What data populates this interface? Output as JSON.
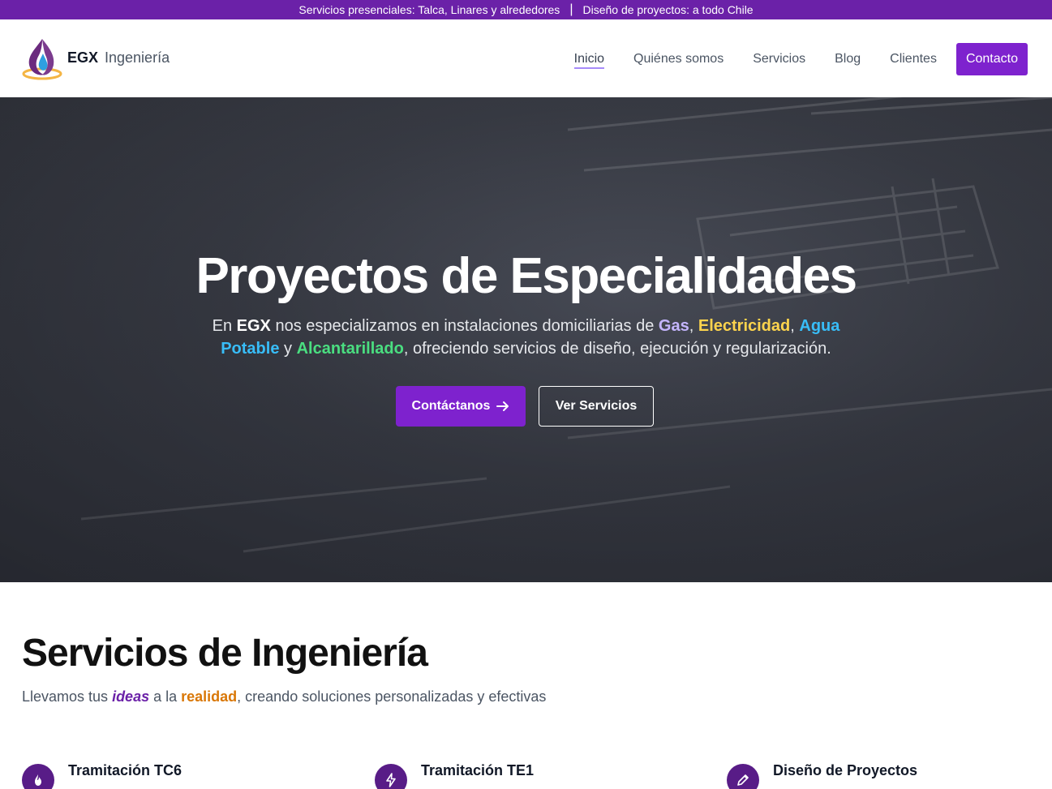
{
  "topbar": {
    "left": "Servicios presenciales: Talca, Linares y alrededores",
    "separator": "|",
    "right": "Diseño de proyectos: a todo Chile"
  },
  "brand": {
    "name": "EGX",
    "suffix": "Ingeniería",
    "logo_icon": "flame-drop-logo"
  },
  "nav": {
    "items": [
      {
        "label": "Inicio",
        "active": true
      },
      {
        "label": "Quiénes somos"
      },
      {
        "label": "Servicios"
      },
      {
        "label": "Blog"
      },
      {
        "label": "Clientes"
      }
    ],
    "cta": "Contacto"
  },
  "hero": {
    "title": "Proyectos de Especialidades",
    "text": {
      "p1": "En ",
      "egx": "EGX",
      "p2": " nos especializamos en instalaciones domiciliarias de ",
      "gas": "Gas",
      "comma1": ", ",
      "electricidad": "Electricidad",
      "comma2": ", ",
      "agua": "Agua Potable",
      "y": " y ",
      "alcantarillado": "Alcantarillado",
      "p3": ", ofreciendo servicios de diseño, ejecución y regularización."
    },
    "primary_button": "Contáctanos",
    "secondary_button": "Ver Servicios"
  },
  "services": {
    "title": "Servicios de Ingeniería",
    "subtitle": {
      "p1": "Llevamos tus ",
      "ideas": "ideas",
      "p2": " a la ",
      "realidad": "realidad",
      "p3": ", creando soluciones personalizadas y efectivas"
    },
    "items": [
      {
        "label": "Tramitación TC6",
        "icon": "flame-icon"
      },
      {
        "label": "Tramitación TE1",
        "icon": "bolt-icon"
      },
      {
        "label": "Diseño de Proyectos",
        "icon": "pencil-icon"
      }
    ]
  },
  "colors": {
    "brand_purple": "#7e22ce",
    "topbar": "#6b21a8",
    "gas": "#c4b5fd",
    "electricidad": "#fcd34d",
    "agua": "#38bdf8",
    "alcantarillado": "#4ade80"
  }
}
